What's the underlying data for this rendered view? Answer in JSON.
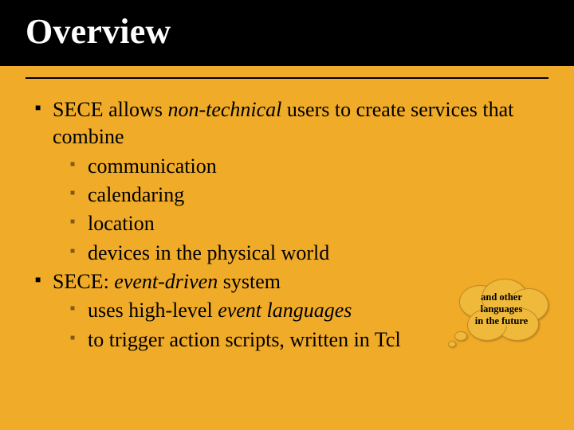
{
  "title": "Overview",
  "bullets": [
    {
      "prefix": "SECE allows ",
      "em": "non-technical",
      "suffix": " users to create services that combine",
      "sub": [
        "communication",
        "calendaring",
        "location",
        "devices in the physical world"
      ]
    },
    {
      "prefix": " SECE: ",
      "em": "event-driven",
      "suffix": " system",
      "sub_runs": [
        {
          "a": " uses high-level ",
          "em": "event languages",
          "b": ""
        },
        {
          "a": " to trigger action scripts, written in Tcl",
          "em": "",
          "b": ""
        }
      ]
    }
  ],
  "cloud": {
    "line1": "and other",
    "line2": "languages",
    "line3": "in the future"
  }
}
